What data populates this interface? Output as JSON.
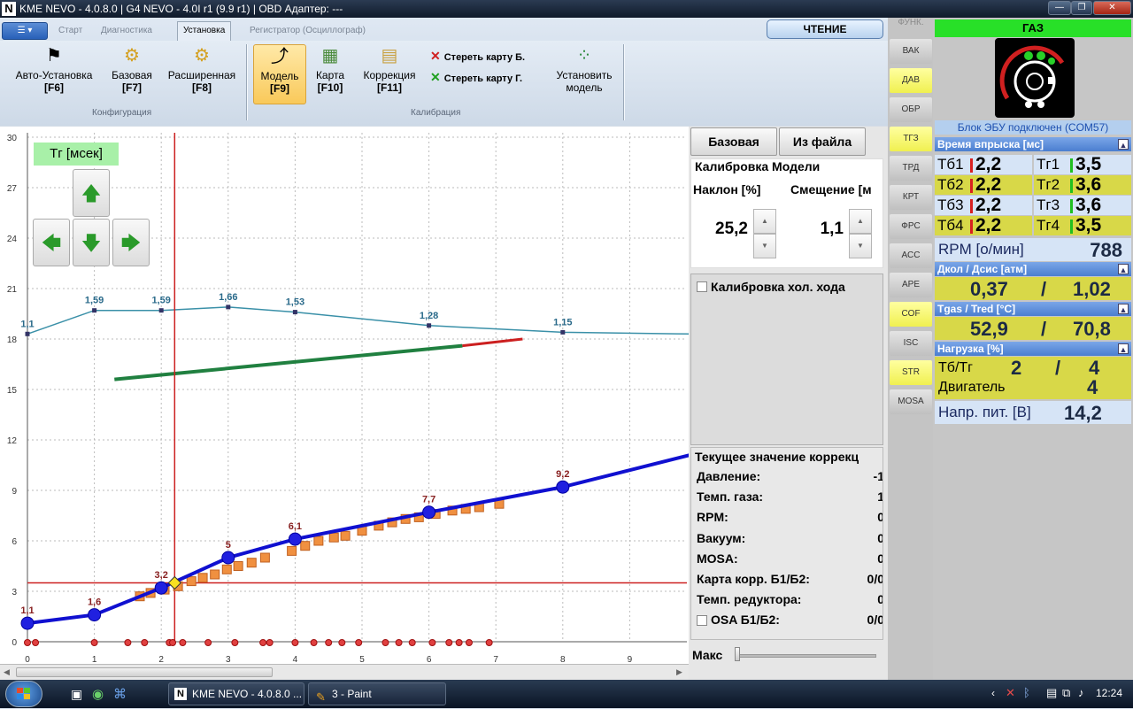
{
  "window": {
    "title": "KME NEVO - 4.0.8.0  |  G4 NEVO - 4.0I r1 (9.9 r1)  |  OBD Адаптер: ---",
    "logo_letter": "N"
  },
  "ribbon": {
    "tabs": [
      "Старт",
      "Диагностика",
      "Установка",
      "Регистратор (Осциллограф)"
    ],
    "active_tab": "Установка",
    "read_button": "ЧТЕНИЕ",
    "config_buttons": [
      {
        "label": "Авто-Установка",
        "key": "[F6]"
      },
      {
        "label": "Базовая",
        "key": "[F7]"
      },
      {
        "label": "Расширенная",
        "key": "[F8]"
      }
    ],
    "config_group": "Конфигурация",
    "calib_buttons": [
      {
        "label": "Модель",
        "key": "[F9]"
      },
      {
        "label": "Карта",
        "key": "[F10]"
      },
      {
        "label": "Коррекция",
        "key": "[F11]"
      }
    ],
    "erase_b": "Стереть карту Б.",
    "erase_g": "Стереть карту Г.",
    "set_model": "Установить модель",
    "calib_group": "Калибрация"
  },
  "graph": {
    "label": "Тг [мсек]",
    "y_ticks": [
      "30",
      "27",
      "24",
      "21",
      "18",
      "15",
      "12",
      "9",
      "6",
      "3",
      "0"
    ],
    "x_ticks": [
      "0",
      "1",
      "2",
      "3",
      "4",
      "5",
      "6",
      "7",
      "8",
      "9"
    ]
  },
  "chart_data": {
    "type": "line",
    "xlim": [
      0,
      9.9
    ],
    "ylim": [
      0,
      30
    ],
    "grid": true,
    "series": [
      {
        "x": [
          0,
          1,
          2,
          3,
          4,
          6,
          8,
          9.9
        ],
        "values": [
          18.3,
          19.7,
          19.7,
          19.9,
          19.6,
          18.8,
          18.4,
          18.3
        ],
        "labels": [
          "1,1",
          "1,59",
          "1,59",
          "1,66",
          "1,53",
          "1,28",
          "1,15",
          ""
        ]
      },
      {
        "x": [
          0,
          1,
          2,
          3,
          4,
          6,
          8,
          9.9
        ],
        "values": [
          1.1,
          1.6,
          3.2,
          5.0,
          6.1,
          7.7,
          9.2,
          11.1
        ],
        "labels": [
          "1,1",
          "1,6",
          "3,2",
          "5",
          "6,1",
          "7,7",
          "9,2",
          ""
        ]
      },
      {
        "x": [
          1.3,
          6.5
        ],
        "values": [
          15.6,
          17.6
        ]
      },
      {
        "x": [
          6.5,
          7.4
        ],
        "values": [
          17.6,
          18.0
        ]
      }
    ],
    "sample_x": [
      1.32,
      1.68,
      1.84,
      2.05,
      2.25,
      2.45,
      2.62,
      2.8,
      2.98,
      3.15,
      3.35,
      3.55,
      3.95,
      4.15,
      4.35,
      4.58,
      4.75,
      5.0,
      5.25,
      5.45,
      5.65,
      5.85,
      6.1,
      6.35,
      6.55,
      6.75,
      7.05
    ],
    "sample_y": [
      0.2,
      2.7,
      2.9,
      3.1,
      3.3,
      3.6,
      3.8,
      4.0,
      4.3,
      4.5,
      4.7,
      5.0,
      5.4,
      5.7,
      6.0,
      6.2,
      6.3,
      6.6,
      6.9,
      7.1,
      7.3,
      7.4,
      7.6,
      7.8,
      7.9,
      8.0,
      8.2
    ],
    "red_x": [
      0.0,
      0.12,
      1.0,
      1.5,
      1.75,
      2.12,
      2.17,
      2.32,
      2.7,
      3.1,
      3.52,
      3.62,
      4.0,
      4.28,
      4.5,
      4.7,
      4.95,
      5.35,
      5.55,
      5.75,
      6.05,
      6.3,
      6.45,
      6.6,
      6.9
    ],
    "crosshair_x": 2.2,
    "crosshair_y": 3.5
  },
  "panel": {
    "base_button": "Базовая",
    "file_button": "Из файла",
    "calib_title": "Калибровка Модели",
    "slope_label": "Наклон [%]",
    "offset_label": "Смещение [м",
    "slope_value": "25,2",
    "offset_value": "1,1",
    "idle_label": "Калибровка хол. хода",
    "corr_title": "Текущее значение коррекц",
    "corr": [
      {
        "label": "Давление:",
        "value": "-1"
      },
      {
        "label": "Темп. газа:",
        "value": "1"
      },
      {
        "label": "RPM:",
        "value": "0"
      },
      {
        "label": "Вакуум:",
        "value": "0"
      },
      {
        "label": "MOSA:",
        "value": "0"
      },
      {
        "label": "Карта корр. Б1/Б2:",
        "value": "0/0"
      },
      {
        "label": "Темп. редуктора:",
        "value": "0"
      },
      {
        "label": "OSA Б1/Б2:",
        "value": "0/0"
      }
    ],
    "max_label": "Макс"
  },
  "func_bar": {
    "title": "ФУНК.",
    "items": [
      {
        "label": "ВАК",
        "lit": false
      },
      {
        "label": "ДАВ",
        "lit": true
      },
      {
        "label": "ОБР",
        "lit": false
      },
      {
        "label": "ТГЗ",
        "lit": true
      },
      {
        "label": "ТРД",
        "lit": false
      },
      {
        "label": "КРТ",
        "lit": false
      },
      {
        "label": "ФРС",
        "lit": false
      },
      {
        "label": "АСС",
        "lit": false
      },
      {
        "label": "АРЕ",
        "lit": false
      },
      {
        "label": "COF",
        "lit": true
      },
      {
        "label": "ISC",
        "lit": false
      },
      {
        "label": "STR",
        "lit": true
      },
      {
        "label": "MOSA",
        "lit": false
      }
    ]
  },
  "status": {
    "gas": "ГАЗ",
    "ecu": "Блок ЭБУ подключен (COM57)",
    "inj_title": "Время впрыска [мс]",
    "inj": [
      {
        "l1": "Тб1",
        "v1": "2,2",
        "l2": "Тг1",
        "v2": "3,5"
      },
      {
        "l1": "Тб2",
        "v1": "2,2",
        "l2": "Тг2",
        "v2": "3,6"
      },
      {
        "l1": "Тб3",
        "v1": "2,2",
        "l2": "Тг3",
        "v2": "3,6"
      },
      {
        "l1": "Тб4",
        "v1": "2,2",
        "l2": "Тг4",
        "v2": "3,5"
      }
    ],
    "rpm_label": "RPM [о/мин]",
    "rpm": "788",
    "press_title": "Дкол / Дсис [атм]",
    "press1": "0,37",
    "press2": "1,02",
    "temp_title": "Tgas / Tred [°C]",
    "temp1": "52,9",
    "temp2": "70,8",
    "load_title": "Нагрузка [%]",
    "load_label1": "Тб/Тг",
    "load_v1": "2",
    "load_v2": "4",
    "load_label2": "Двигатель",
    "load_v3": "4",
    "volt_label": "Напр. пит. [В]",
    "volt": "14,2",
    "slash": "/"
  },
  "taskbar": {
    "items": [
      "KME NEVO - 4.0.8.0 ...",
      "3 - Paint"
    ],
    "time": "12:24"
  },
  "colors": {
    "blue_line": "#1010d0",
    "model_line": "#3a90a8",
    "red": "#cc2020",
    "green_line": "#208040",
    "yellow_btn": "#f0f050"
  }
}
